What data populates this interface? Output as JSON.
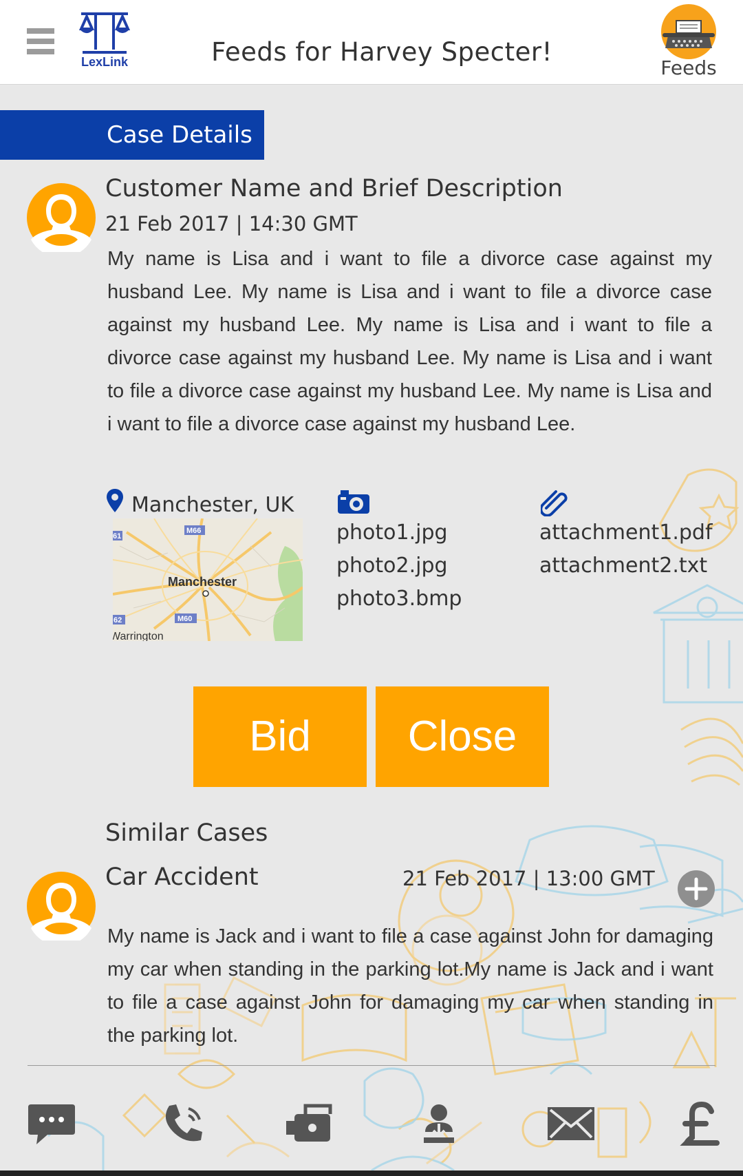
{
  "header": {
    "logo_text": "LexLink",
    "title": "Feeds for Harvey Specter!",
    "feeds_label": "Feeds"
  },
  "case": {
    "section_label": "Case Details",
    "title": "Customer Name and Brief Description",
    "date": "21 Feb 2017 | 14:30 GMT",
    "description": "My name is Lisa and i want to file a divorce case against my husband Lee. My name is Lisa and i want to file a divorce case against my husband Lee. My name is Lisa and i want to file a divorce case against my husband Lee. My name is Lisa and i want to file a divorce case against my husband Lee. My name is Lisa and i want to file a divorce case against my husband Lee.",
    "location": "Manchester, UK",
    "map_labels": {
      "city": "Manchester",
      "m66": "M66",
      "m60": "M60",
      "m62": "62",
      "m61": "61",
      "warrington": "Warrington"
    },
    "photos": [
      "photo1.jpg",
      "photo2.jpg",
      "photo3.bmp"
    ],
    "attachments": [
      "attachment1.pdf",
      "attachment2.txt"
    ]
  },
  "actions": {
    "bid_label": "Bid",
    "close_label": "Close"
  },
  "similar": {
    "heading": "Similar Cases",
    "items": [
      {
        "title": "Car Accident",
        "date": "21 Feb 2017 | 13:00 GMT",
        "description": "My name is Jack and i want to file a case against John for damaging my car when standing in the parking lot.My name is Jack and i want to file a case against John for damaging my car when standing in the parking lot."
      }
    ]
  },
  "colors": {
    "accent_orange": "#ffa400",
    "brand_blue": "#0b3fa8",
    "background": "#e8e8e8"
  },
  "bottom_nav": [
    "chat-icon",
    "phone-icon",
    "video-camera-icon",
    "download-user-icon",
    "mail-icon",
    "pound-icon"
  ]
}
